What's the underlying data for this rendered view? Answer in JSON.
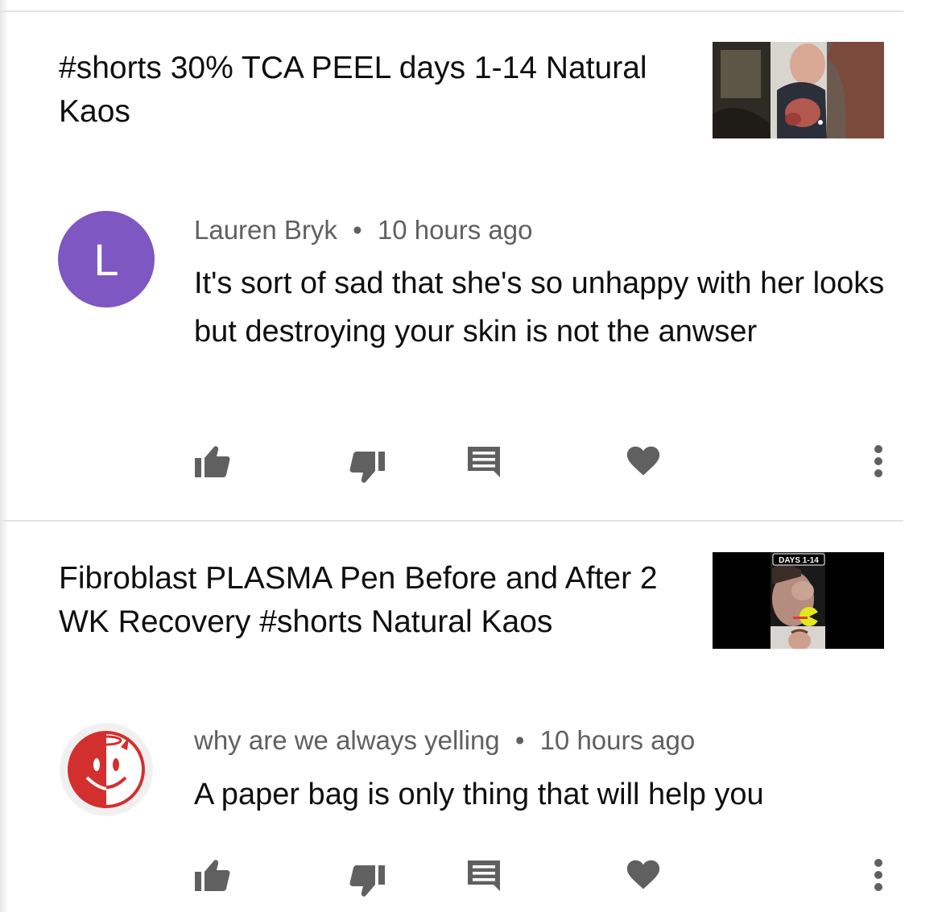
{
  "items": [
    {
      "video_title": "#shorts 30% TCA PEEL days 1-14 Natural Kaos",
      "thumbnail": {
        "overlay_text": ""
      },
      "comment": {
        "avatar_letter": "L",
        "author": "Lauren Bryk",
        "separator": "•",
        "time": "10 hours ago",
        "text": "It's sort of sad that she's so unhappy with her looks but destroying your skin is not the anwser"
      }
    },
    {
      "video_title": "Fibroblast PLASMA Pen Before and After 2 WK Recovery #shorts Natural Kaos",
      "thumbnail": {
        "overlay_text": "DAYS 1-14"
      },
      "comment": {
        "avatar_letter": "",
        "author": "why are we always yelling",
        "separator": "•",
        "time": "10 hours ago",
        "text": "A paper bag is only thing that will help you"
      }
    }
  ],
  "icons": {
    "like": "thumb-up-icon",
    "dislike": "thumb-down-icon",
    "reply": "reply-icon",
    "heart": "heart-icon",
    "more": "more-vert-icon"
  },
  "colors": {
    "icon": "#606060",
    "avatar_purple": "#7e57c2",
    "avatar_red": "#d32f2f",
    "divider": "#e3e3e3"
  }
}
